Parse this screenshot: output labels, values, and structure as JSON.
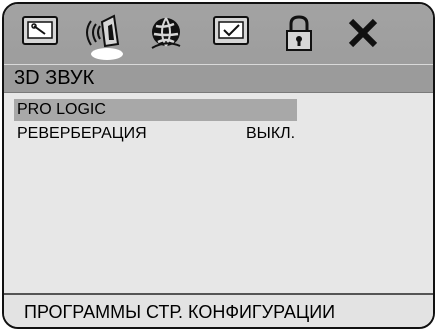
{
  "menu": {
    "tabs": [
      {
        "icon": "settings-screen-icon"
      },
      {
        "icon": "audio-speaker-icon",
        "active": true
      },
      {
        "icon": "globe-language-icon"
      },
      {
        "icon": "checkmark-screen-icon"
      },
      {
        "icon": "lock-icon"
      },
      {
        "icon": "close-icon"
      }
    ],
    "section_title": "3D ЗВУК",
    "items": [
      {
        "label": "PRO LOGIC",
        "value": "",
        "selected": true
      },
      {
        "label": "РЕВЕРБЕРАЦИЯ",
        "value": "ВЫКЛ.",
        "selected": false
      }
    ],
    "status": "ПРОГРАММЫ СТР. КОНФИГУРАЦИИ"
  },
  "colors": {
    "toolbar_bg": "#a3a3a3",
    "title_bg": "#9b9b9b",
    "content_bg": "#e7e7e7",
    "selection_bg": "#a8a8a8"
  }
}
